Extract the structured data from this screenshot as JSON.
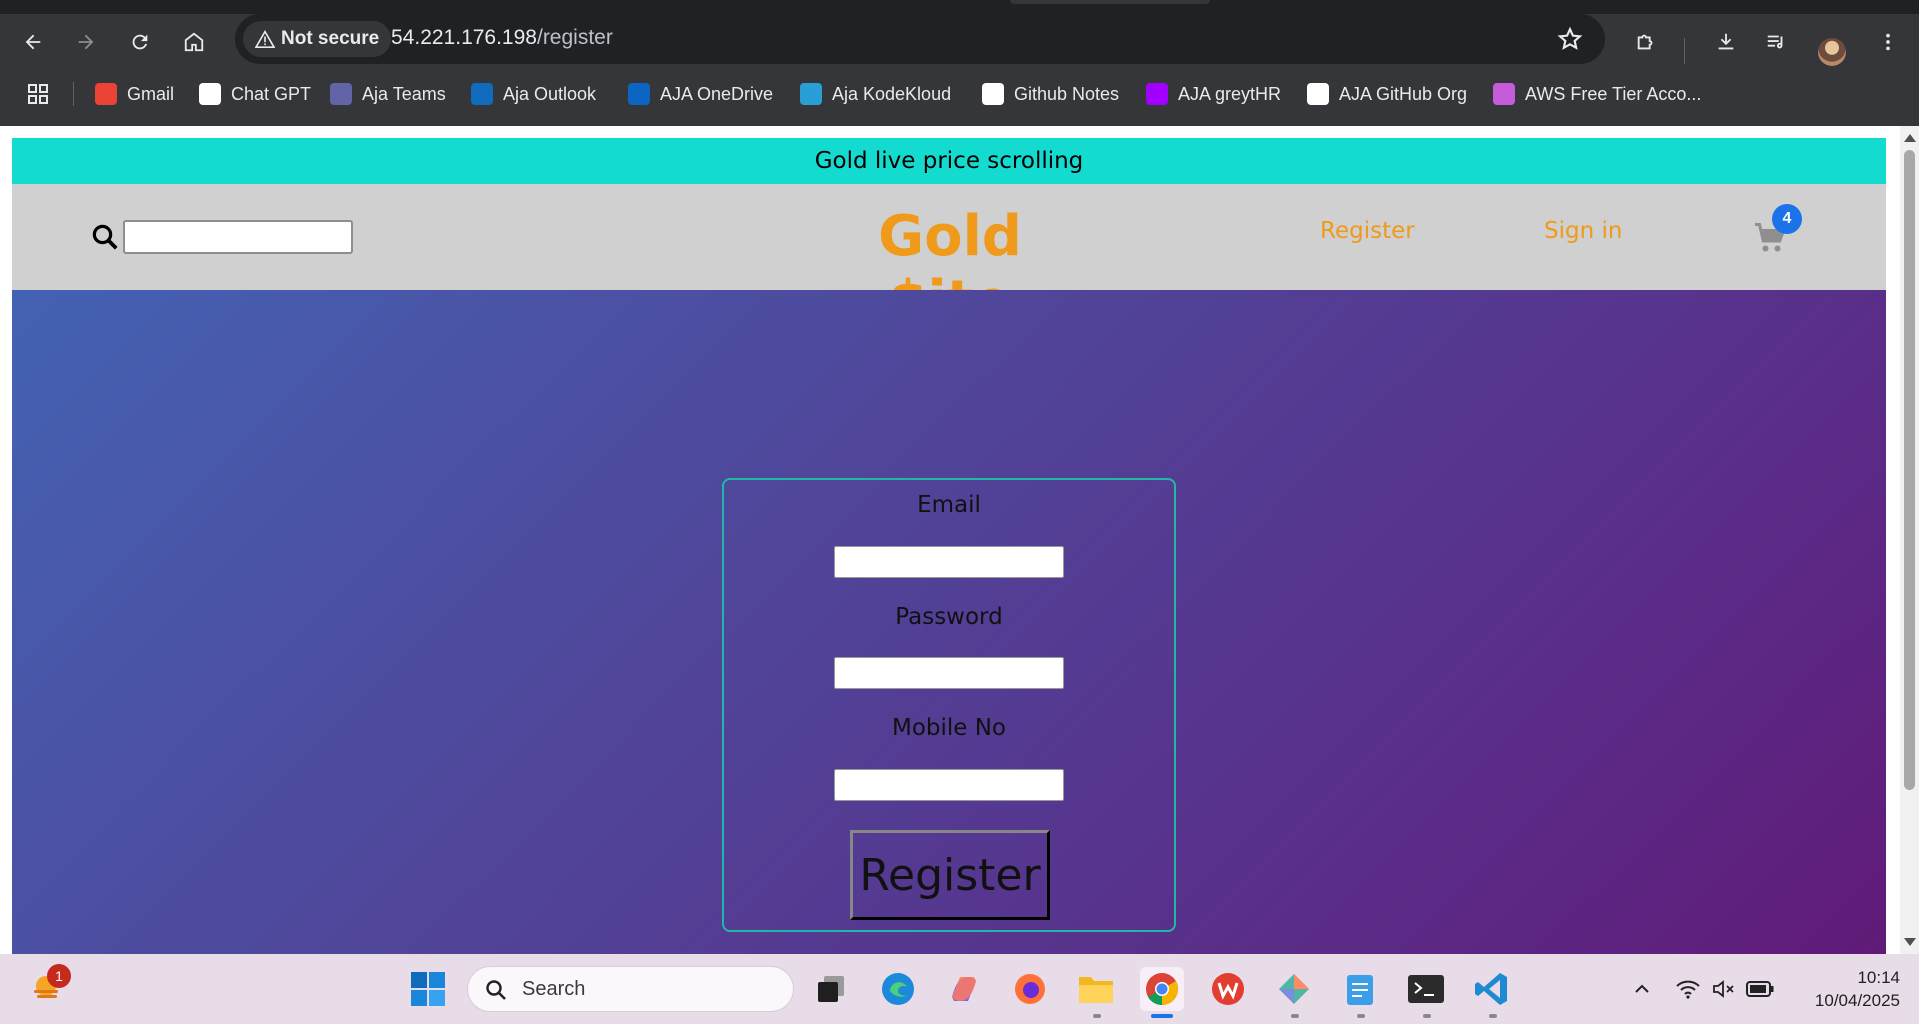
{
  "browser": {
    "security_label": "Not secure",
    "url_host": "54.221.176.198",
    "url_path": "/register"
  },
  "bookmarks": [
    {
      "label": "Gmail",
      "icon": "gmail-icon",
      "color": "#ea4335"
    },
    {
      "label": "Chat GPT",
      "icon": "chatgpt-icon",
      "color": "#ffffff"
    },
    {
      "label": "Aja Teams",
      "icon": "teams-icon",
      "color": "#6264a7"
    },
    {
      "label": "Aja Outlook",
      "icon": "outlook-icon",
      "color": "#0f6cbd"
    },
    {
      "label": "AJA OneDrive",
      "icon": "onedrive-icon",
      "color": "#0a66c2"
    },
    {
      "label": "Aja KodeKloud",
      "icon": "kodekloud-icon",
      "color": "#2a9fd6"
    },
    {
      "label": "Github Notes",
      "icon": "github-icon",
      "color": "#ffffff"
    },
    {
      "label": "AJA greytHR",
      "icon": "greythr-icon",
      "color": "#a100ff"
    },
    {
      "label": "AJA GitHub Org",
      "icon": "github-icon",
      "color": "#ffffff"
    },
    {
      "label": "AWS Free Tier Acco...",
      "icon": "aws-cube-icon",
      "color": "#c55bd8"
    }
  ],
  "site": {
    "ticker_text": "Gold live price scrolling",
    "brand": "Gold $ite",
    "nav_register": "Register",
    "nav_signin": "Sign in",
    "cart_count": "4",
    "brand_color": "#ef9a1a",
    "ticker_color": "#14dbcf"
  },
  "form": {
    "email_label": "Email",
    "password_label": "Password",
    "mobile_label": "Mobile No",
    "submit_label": "Register"
  },
  "taskbar": {
    "search_placeholder": "Search",
    "weather_badge": "1",
    "time": "10:14",
    "date": "10/04/2025"
  }
}
